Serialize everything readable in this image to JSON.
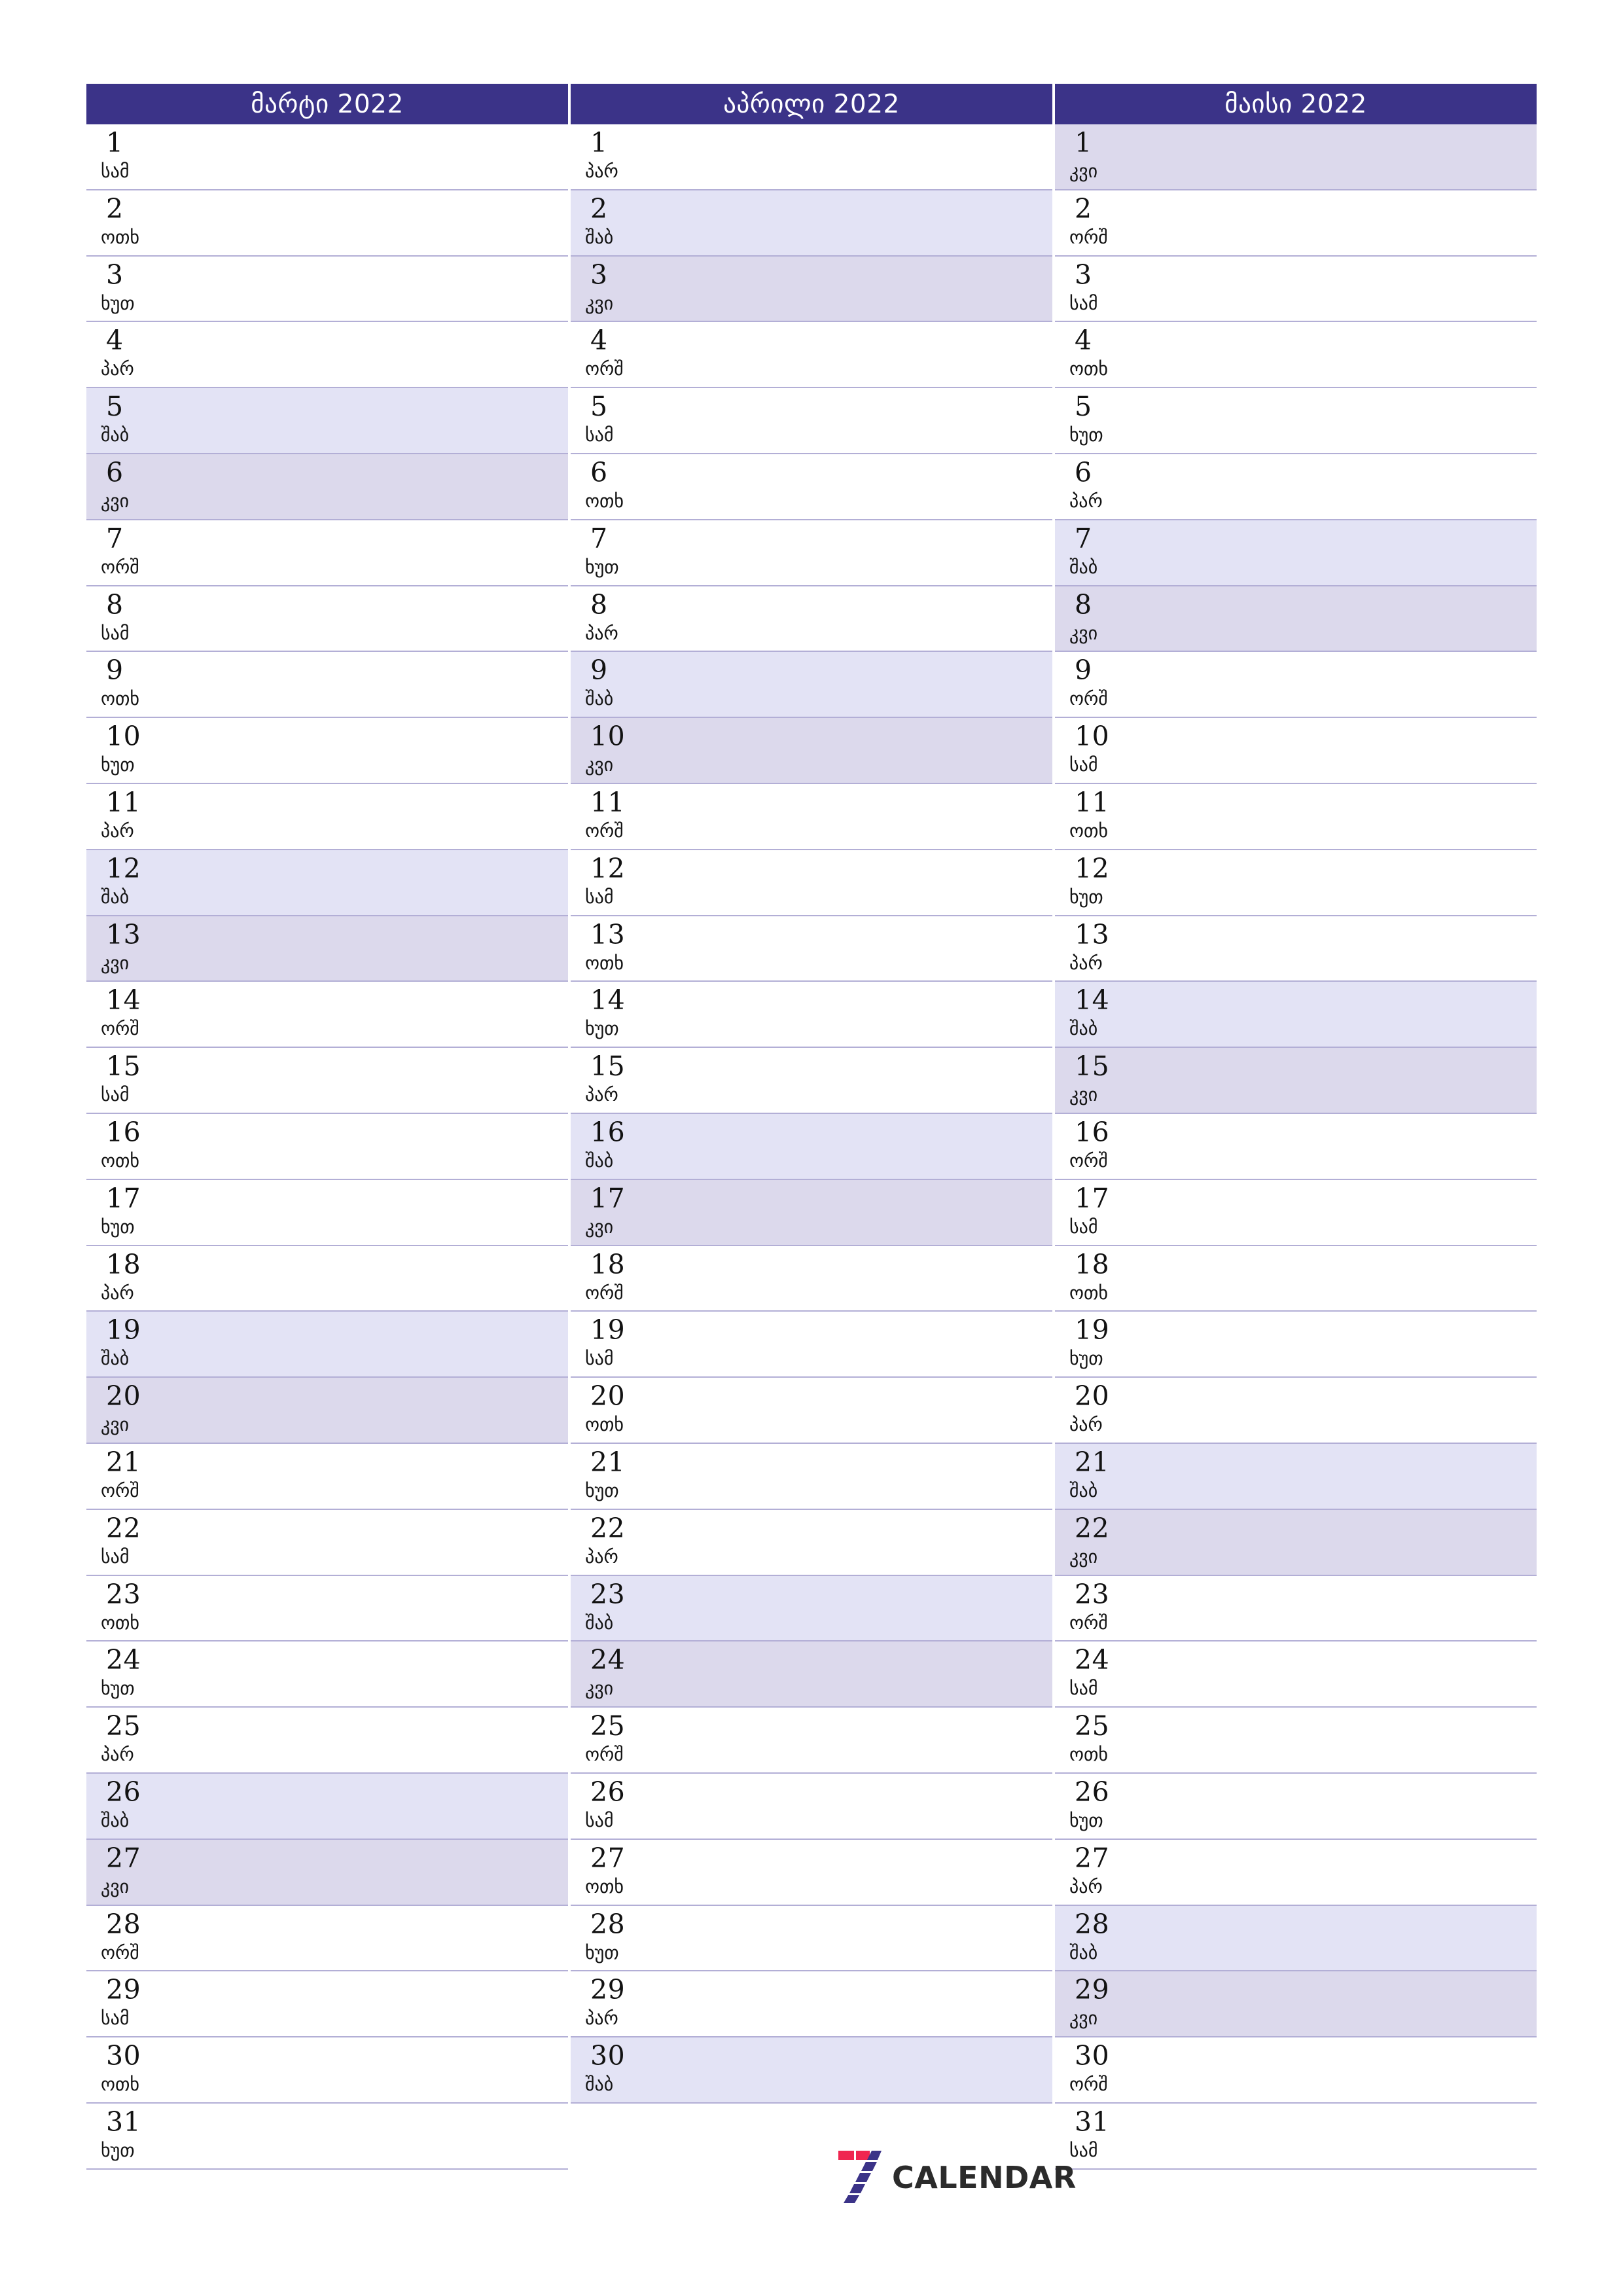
{
  "page": {
    "title": "7CALENDAR quarterly planner",
    "background_color": "#ffffff",
    "header_color": "#3b3388",
    "saturday_color": "#e3e3f5",
    "sunday_color": "#dcd9ec",
    "rule_color": "#b3afd6",
    "logo_red": "#ef2650",
    "logo_purple": "#3b3388",
    "logo_text_color": "#2b2b2b"
  },
  "branding": {
    "logo_text": "CALENDAR",
    "logo_mark": "seven-stripes-icon"
  },
  "weekday_names": {
    "mon": "ორშ",
    "tue": "სამ",
    "wed": "ოთხ",
    "thu": "ხუთ",
    "fri": "პარ",
    "sat": "შაბ",
    "sun": "კვი"
  },
  "months": [
    {
      "title": "მარტი 2022",
      "name": "march",
      "days": [
        {
          "num": "1",
          "wd": "სამ",
          "type": "weekday"
        },
        {
          "num": "2",
          "wd": "ოთხ",
          "type": "weekday"
        },
        {
          "num": "3",
          "wd": "ხუთ",
          "type": "weekday"
        },
        {
          "num": "4",
          "wd": "პარ",
          "type": "weekday"
        },
        {
          "num": "5",
          "wd": "შაბ",
          "type": "sat"
        },
        {
          "num": "6",
          "wd": "კვი",
          "type": "sun"
        },
        {
          "num": "7",
          "wd": "ორშ",
          "type": "weekday"
        },
        {
          "num": "8",
          "wd": "სამ",
          "type": "weekday"
        },
        {
          "num": "9",
          "wd": "ოთხ",
          "type": "weekday"
        },
        {
          "num": "10",
          "wd": "ხუთ",
          "type": "weekday"
        },
        {
          "num": "11",
          "wd": "პარ",
          "type": "weekday"
        },
        {
          "num": "12",
          "wd": "შაბ",
          "type": "sat"
        },
        {
          "num": "13",
          "wd": "კვი",
          "type": "sun"
        },
        {
          "num": "14",
          "wd": "ორშ",
          "type": "weekday"
        },
        {
          "num": "15",
          "wd": "სამ",
          "type": "weekday"
        },
        {
          "num": "16",
          "wd": "ოთხ",
          "type": "weekday"
        },
        {
          "num": "17",
          "wd": "ხუთ",
          "type": "weekday"
        },
        {
          "num": "18",
          "wd": "პარ",
          "type": "weekday"
        },
        {
          "num": "19",
          "wd": "შაბ",
          "type": "sat"
        },
        {
          "num": "20",
          "wd": "კვი",
          "type": "sun"
        },
        {
          "num": "21",
          "wd": "ორშ",
          "type": "weekday"
        },
        {
          "num": "22",
          "wd": "სამ",
          "type": "weekday"
        },
        {
          "num": "23",
          "wd": "ოთხ",
          "type": "weekday"
        },
        {
          "num": "24",
          "wd": "ხუთ",
          "type": "weekday"
        },
        {
          "num": "25",
          "wd": "პარ",
          "type": "weekday"
        },
        {
          "num": "26",
          "wd": "შაბ",
          "type": "sat"
        },
        {
          "num": "27",
          "wd": "კვი",
          "type": "sun"
        },
        {
          "num": "28",
          "wd": "ორშ",
          "type": "weekday"
        },
        {
          "num": "29",
          "wd": "სამ",
          "type": "weekday"
        },
        {
          "num": "30",
          "wd": "ოთხ",
          "type": "weekday"
        },
        {
          "num": "31",
          "wd": "ხუთ",
          "type": "weekday"
        }
      ]
    },
    {
      "title": "აპრილი 2022",
      "name": "april",
      "days": [
        {
          "num": "1",
          "wd": "პარ",
          "type": "weekday"
        },
        {
          "num": "2",
          "wd": "შაბ",
          "type": "sat"
        },
        {
          "num": "3",
          "wd": "კვი",
          "type": "sun"
        },
        {
          "num": "4",
          "wd": "ორშ",
          "type": "weekday"
        },
        {
          "num": "5",
          "wd": "სამ",
          "type": "weekday"
        },
        {
          "num": "6",
          "wd": "ოთხ",
          "type": "weekday"
        },
        {
          "num": "7",
          "wd": "ხუთ",
          "type": "weekday"
        },
        {
          "num": "8",
          "wd": "პარ",
          "type": "weekday"
        },
        {
          "num": "9",
          "wd": "შაბ",
          "type": "sat"
        },
        {
          "num": "10",
          "wd": "კვი",
          "type": "sun"
        },
        {
          "num": "11",
          "wd": "ორშ",
          "type": "weekday"
        },
        {
          "num": "12",
          "wd": "სამ",
          "type": "weekday"
        },
        {
          "num": "13",
          "wd": "ოთხ",
          "type": "weekday"
        },
        {
          "num": "14",
          "wd": "ხუთ",
          "type": "weekday"
        },
        {
          "num": "15",
          "wd": "პარ",
          "type": "weekday"
        },
        {
          "num": "16",
          "wd": "შაბ",
          "type": "sat"
        },
        {
          "num": "17",
          "wd": "კვი",
          "type": "sun"
        },
        {
          "num": "18",
          "wd": "ორშ",
          "type": "weekday"
        },
        {
          "num": "19",
          "wd": "სამ",
          "type": "weekday"
        },
        {
          "num": "20",
          "wd": "ოთხ",
          "type": "weekday"
        },
        {
          "num": "21",
          "wd": "ხუთ",
          "type": "weekday"
        },
        {
          "num": "22",
          "wd": "პარ",
          "type": "weekday"
        },
        {
          "num": "23",
          "wd": "შაბ",
          "type": "sat"
        },
        {
          "num": "24",
          "wd": "კვი",
          "type": "sun"
        },
        {
          "num": "25",
          "wd": "ორშ",
          "type": "weekday"
        },
        {
          "num": "26",
          "wd": "სამ",
          "type": "weekday"
        },
        {
          "num": "27",
          "wd": "ოთხ",
          "type": "weekday"
        },
        {
          "num": "28",
          "wd": "ხუთ",
          "type": "weekday"
        },
        {
          "num": "29",
          "wd": "პარ",
          "type": "weekday"
        },
        {
          "num": "30",
          "wd": "შაბ",
          "type": "sat"
        }
      ]
    },
    {
      "title": "მაისი 2022",
      "name": "may",
      "days": [
        {
          "num": "1",
          "wd": "კვი",
          "type": "sun"
        },
        {
          "num": "2",
          "wd": "ორშ",
          "type": "weekday"
        },
        {
          "num": "3",
          "wd": "სამ",
          "type": "weekday"
        },
        {
          "num": "4",
          "wd": "ოთხ",
          "type": "weekday"
        },
        {
          "num": "5",
          "wd": "ხუთ",
          "type": "weekday"
        },
        {
          "num": "6",
          "wd": "პარ",
          "type": "weekday"
        },
        {
          "num": "7",
          "wd": "შაბ",
          "type": "sat"
        },
        {
          "num": "8",
          "wd": "კვი",
          "type": "sun"
        },
        {
          "num": "9",
          "wd": "ორშ",
          "type": "weekday"
        },
        {
          "num": "10",
          "wd": "სამ",
          "type": "weekday"
        },
        {
          "num": "11",
          "wd": "ოთხ",
          "type": "weekday"
        },
        {
          "num": "12",
          "wd": "ხუთ",
          "type": "weekday"
        },
        {
          "num": "13",
          "wd": "პარ",
          "type": "weekday"
        },
        {
          "num": "14",
          "wd": "შაბ",
          "type": "sat"
        },
        {
          "num": "15",
          "wd": "კვი",
          "type": "sun"
        },
        {
          "num": "16",
          "wd": "ორშ",
          "type": "weekday"
        },
        {
          "num": "17",
          "wd": "სამ",
          "type": "weekday"
        },
        {
          "num": "18",
          "wd": "ოთხ",
          "type": "weekday"
        },
        {
          "num": "19",
          "wd": "ხუთ",
          "type": "weekday"
        },
        {
          "num": "20",
          "wd": "პარ",
          "type": "weekday"
        },
        {
          "num": "21",
          "wd": "შაბ",
          "type": "sat"
        },
        {
          "num": "22",
          "wd": "კვი",
          "type": "sun"
        },
        {
          "num": "23",
          "wd": "ორშ",
          "type": "weekday"
        },
        {
          "num": "24",
          "wd": "სამ",
          "type": "weekday"
        },
        {
          "num": "25",
          "wd": "ოთხ",
          "type": "weekday"
        },
        {
          "num": "26",
          "wd": "ხუთ",
          "type": "weekday"
        },
        {
          "num": "27",
          "wd": "პარ",
          "type": "weekday"
        },
        {
          "num": "28",
          "wd": "შაბ",
          "type": "sat"
        },
        {
          "num": "29",
          "wd": "კვი",
          "type": "sun"
        },
        {
          "num": "30",
          "wd": "ორშ",
          "type": "weekday"
        },
        {
          "num": "31",
          "wd": "სამ",
          "type": "weekday"
        }
      ]
    }
  ]
}
